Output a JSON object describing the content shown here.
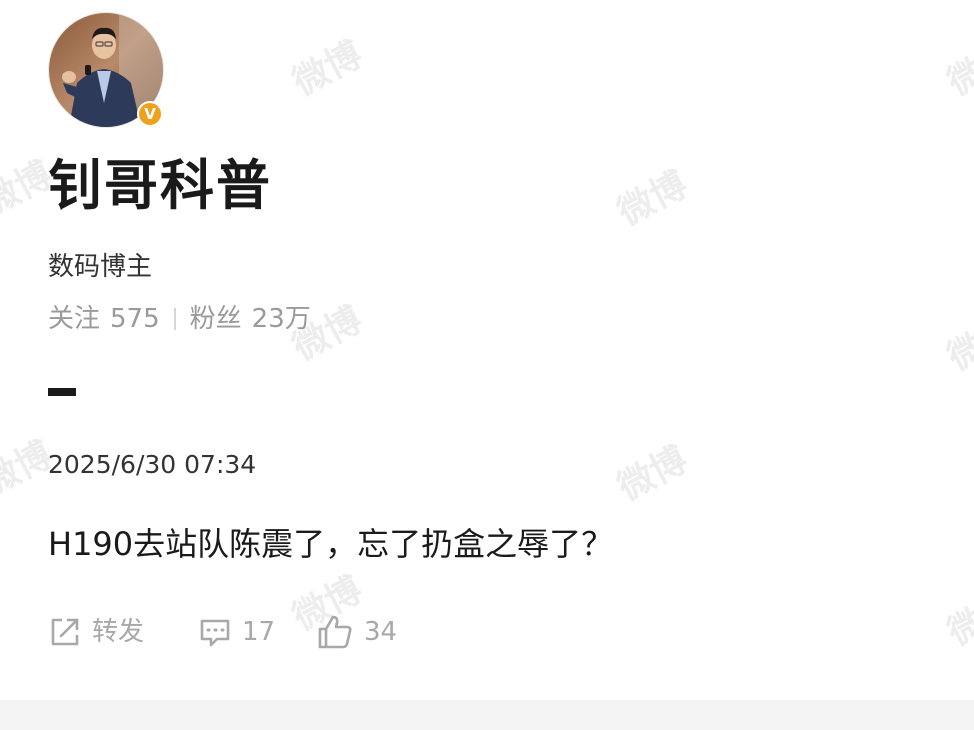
{
  "profile": {
    "name": "钊哥科普",
    "category": "数码博主",
    "following_label": "关注",
    "following_count": "575",
    "followers_label": "粉丝",
    "followers_count": "23万",
    "verified_mark": "V"
  },
  "post": {
    "timestamp": "2025/6/30 07:34",
    "text": "H190去站队陈震了，忘了扔盒之辱了？"
  },
  "actions": {
    "forward_label": "转发",
    "comment_count": "17",
    "like_count": "34"
  },
  "watermark": {
    "text": "微博"
  },
  "icons": {
    "forward": "share-icon",
    "comment": "comment-icon",
    "like": "thumbs-up-icon",
    "verified": "verified-badge-icon"
  },
  "colors": {
    "verified_badge": "#f0a11c",
    "primary_text": "#1a1a1a",
    "secondary_text": "#9a9a9a",
    "action_gray": "#a8a8a8"
  }
}
